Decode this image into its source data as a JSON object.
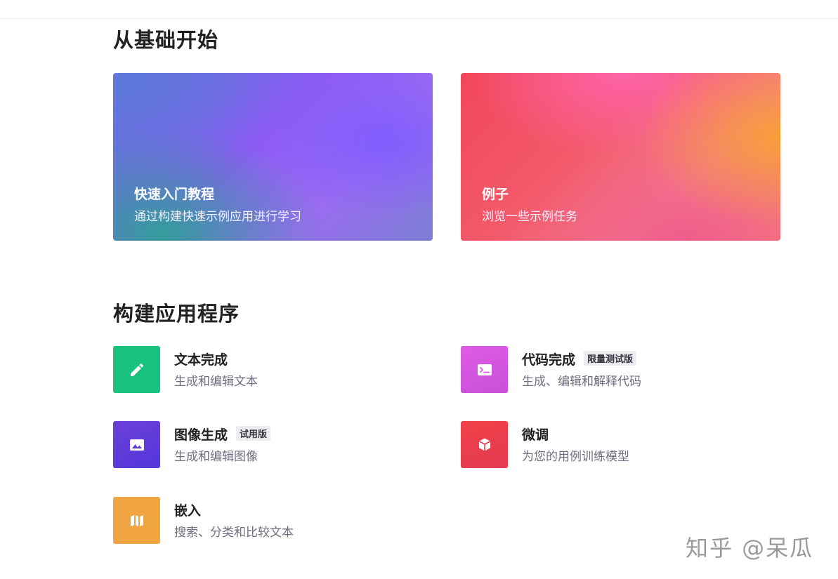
{
  "sections": {
    "basics_title": "从基础开始",
    "build_title": "构建应用程序"
  },
  "hero_cards": [
    {
      "title": "快速入门教程",
      "description": "通过构建快速示例应用进行学习"
    },
    {
      "title": "例子",
      "description": "浏览一些示例任务"
    }
  ],
  "apps": {
    "text": {
      "name": "文本完成",
      "description": "生成和编辑文本",
      "icon": "pencil-icon",
      "color": "#19c37d"
    },
    "code": {
      "name": "代码完成",
      "badge": "限量测试版",
      "description": "生成、编辑和解释代码",
      "icon": "terminal-icon",
      "color": "#dd5ce5"
    },
    "image": {
      "name": "图像生成",
      "badge": "试用版",
      "description": "生成和编辑图像",
      "icon": "image-icon",
      "color": "#5436da"
    },
    "finetune": {
      "name": "微调",
      "description": "为您的用例训练模型",
      "icon": "cube-icon",
      "color": "#ef4146"
    },
    "embed": {
      "name": "嵌入",
      "description": "搜索、分类和比较文本",
      "icon": "map-icon",
      "color": "#f0a442"
    }
  },
  "watermark": "知乎 @呆瓜"
}
